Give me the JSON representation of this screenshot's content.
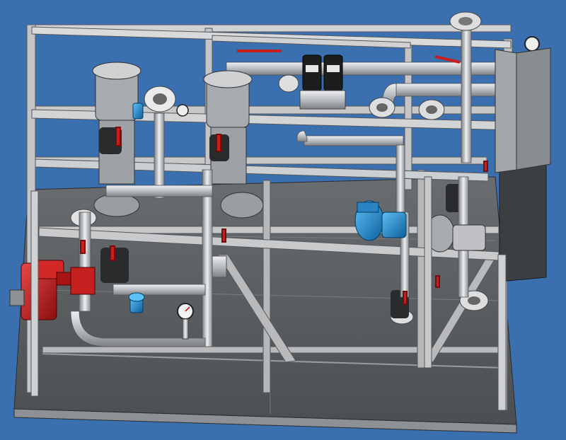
{
  "viewport": {
    "background": "#3a6fb0",
    "frame_color": "#c8cacc",
    "pipe_color": "#d4d6d8",
    "skid_floor_color": "#5a5d60",
    "valve_red": "#c81e1e",
    "accent_blue": "#1f8fd6",
    "enclosure_dark": "#3c3f42"
  },
  "icons": {
    "pressure_gauge": "pressure-gauge-icon",
    "flange": "flange-icon",
    "handwheel": "valve-handle-icon"
  }
}
